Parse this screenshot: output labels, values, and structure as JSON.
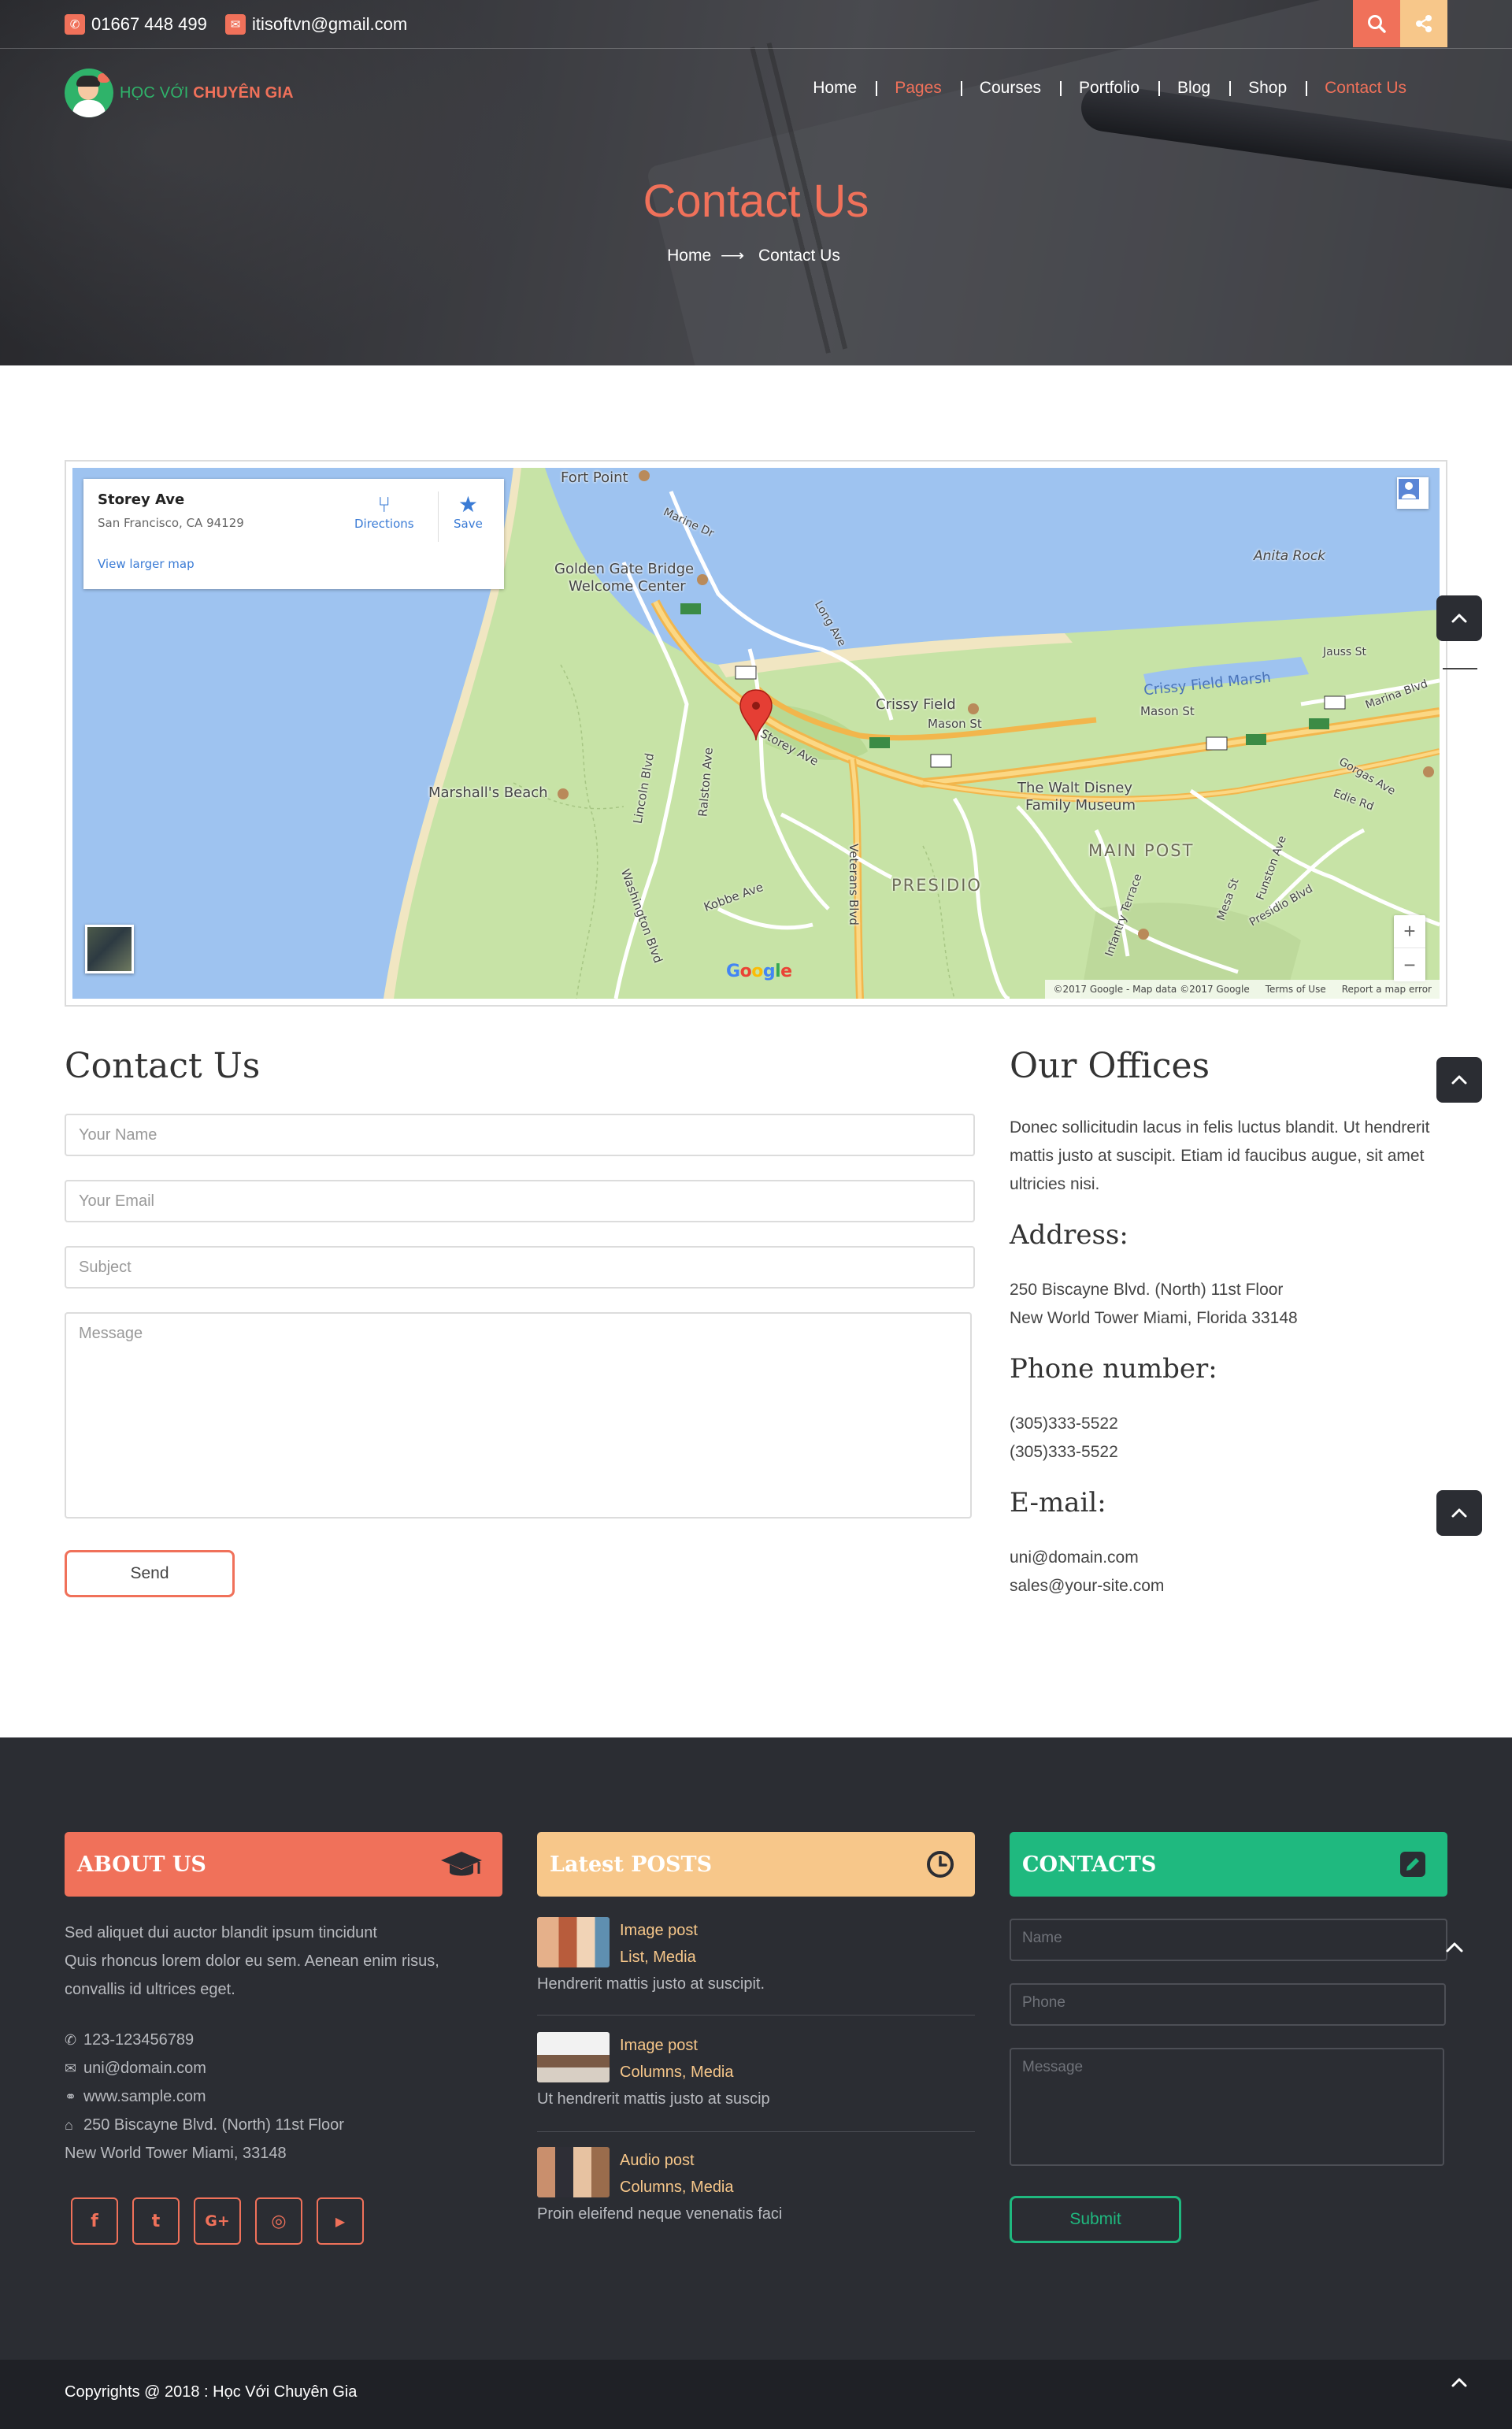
{
  "topbar": {
    "phone": "01667 448 499",
    "email": "itisoftvn@gmail.com",
    "colors": {
      "search_bg": "#f0715a",
      "share_bg": "#f7c78a"
    }
  },
  "logo": {
    "part1": "HỌC VỚI ",
    "part2": "CHUYÊN GIA"
  },
  "nav": {
    "items": [
      {
        "label": "Home"
      },
      {
        "label": "Pages"
      },
      {
        "label": "Courses"
      },
      {
        "label": "Portfolio"
      },
      {
        "label": "Blog"
      },
      {
        "label": "Shop"
      },
      {
        "label": "Contact Us"
      }
    ]
  },
  "hero": {
    "title": "Contact Us",
    "breadcrumb": {
      "home": "Home",
      "arrow": "⟶",
      "current": "Contact Us"
    }
  },
  "map": {
    "card": {
      "title": "Storey Ave",
      "address": "San Francisco, CA 94129",
      "larger": "View larger map",
      "directions": "Directions",
      "save": "Save"
    },
    "labels": {
      "fort_point": "Fort Point",
      "ggb": "Golden Gate Bridge",
      "welcome": "Welcome Center",
      "anita": "Anita Rock",
      "crissy_marsh": "Crissy Field Marsh",
      "crissy_field": "Crissy Field",
      "mason": "Mason St",
      "mason2": "Mason St",
      "marshalls": "Marshall's Beach",
      "disney1": "The Walt Disney",
      "disney2": "Family Museum",
      "main_post": "MAIN POST",
      "presidio": "PRESIDIO",
      "storey": "Storey Ave",
      "veterans": "Veterans Blvd",
      "lincoln": "Lincoln Blvd",
      "kobbe": "Kobbe Ave",
      "ralston": "Ralston Ave",
      "washington": "Washington Blvd",
      "marine": "Marine Dr",
      "long": "Long Ave",
      "jauss": "Jauss St",
      "marina": "Marina Blvd",
      "gorgas": "Gorgas Ave",
      "edie": "Edie Rd",
      "infantry": "Infantry Terrace",
      "mesa": "Mesa St",
      "funston": "Funston Ave",
      "presidio_blvd": "Presidio Blvd"
    },
    "footer": {
      "data": "©2017 Google - Map data ©2017 Google",
      "terms": "Terms of Use",
      "report": "Report a map error"
    },
    "google": "Google",
    "zoom_in": "+",
    "zoom_out": "−"
  },
  "contact_form": {
    "title": "Contact Us",
    "name_placeholder": "Your Name",
    "email_placeholder": "Your Email",
    "subject_placeholder": "Subject",
    "message_placeholder": "Message",
    "send": "Send"
  },
  "offices": {
    "title": "Our Offices",
    "intro": "Donec sollicitudin lacus in felis luctus blandit. Ut hendrerit mattis justo at suscipit. Etiam id faucibus augue, sit amet ultricies nisi.",
    "address_title": "Address:",
    "address_1": "250 Biscayne Blvd. (North) 11st Floor",
    "address_2": "New World Tower Miami, Florida 33148",
    "phone_title": "Phone number:",
    "phone_1": "(305)333-5522",
    "phone_2": "(305)333-5522",
    "email_title": "E-mail:",
    "email_1": "uni@domain.com",
    "email_2": "sales@your-site.com"
  },
  "footer": {
    "about": {
      "title": "ABOUT US",
      "line_1": "Sed aliquet dui auctor blandit ipsum tincidunt",
      "line_2": "Quis rhoncus lorem dolor eu sem. Aenean enim risus,",
      "line_3": "convallis id ultrices eget.",
      "phone": "123-123456789",
      "email": "uni@domain.com",
      "web": "www.sample.com",
      "address_1": "250 Biscayne Blvd. (North) 11st Floor",
      "address_2": "New World Tower Miami, 33148",
      "color": "#f0715a"
    },
    "social": [
      {
        "icon": "facebook-icon",
        "glyph": "f"
      },
      {
        "icon": "twitter-icon",
        "glyph": "t"
      },
      {
        "icon": "google-plus-icon",
        "glyph": "G+"
      },
      {
        "icon": "dribbble-icon",
        "glyph": "◎"
      },
      {
        "icon": "youtube-icon",
        "glyph": "▶"
      }
    ],
    "posts": {
      "title": "Latest POSTS",
      "color": "#f7c78a",
      "items": [
        {
          "title": "Image post",
          "cats": "List, Media",
          "excerpt": "Hendrerit mattis justo at suscipit."
        },
        {
          "title": "Image post",
          "cats": "Columns, Media",
          "excerpt": "Ut hendrerit mattis justo at suscip"
        },
        {
          "title": "Audio post",
          "cats": "Columns, Media",
          "excerpt": "Proin eleifend neque venenatis faci"
        }
      ]
    },
    "contacts": {
      "title": "CONTACTS",
      "color": "#1fb97f",
      "name_placeholder": "Name",
      "phone_placeholder": "Phone",
      "message_placeholder": "Message",
      "submit": "Submit"
    },
    "copyright": "Copyrights @ 2018 : Học Với Chuyên Gia"
  }
}
